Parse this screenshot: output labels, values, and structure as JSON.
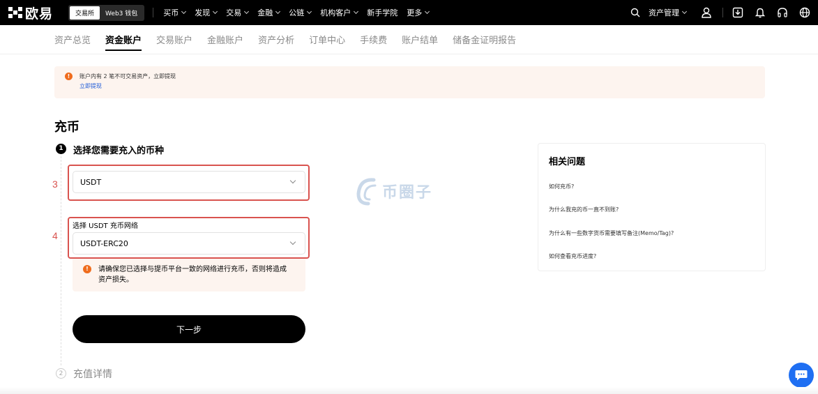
{
  "nav": {
    "logo": "欧易",
    "modes": [
      "交易所",
      "Web3 钱包"
    ],
    "items": [
      "买币",
      "发现",
      "交易",
      "金融",
      "公链",
      "机构客户",
      "新手学院",
      "更多"
    ],
    "has_chevron": [
      true,
      true,
      true,
      true,
      true,
      true,
      false,
      true
    ],
    "asset_mgmt": "资产管理"
  },
  "subtabs": [
    "资产总览",
    "资金账户",
    "交易账户",
    "金融账户",
    "资产分析",
    "订单中心",
    "手续费",
    "账户结单",
    "储备金证明报告"
  ],
  "banner": {
    "text": "账户内有 2 笔不可交易资产，立即提现",
    "link": "立即提现"
  },
  "page": {
    "title": "充币",
    "step1_number": "1",
    "step1_label": "选择您需要充入的币种",
    "step2_number": "2",
    "step2_label": "充值详情"
  },
  "coin_select": {
    "value": "USDT"
  },
  "network": {
    "label": "选择 USDT 充币网络",
    "value": "USDT-ERC20"
  },
  "warning": {
    "text": "请确保您已选择与提币平台一致的网络进行充币，否则将造成资产损失。"
  },
  "next_button": "下一步",
  "annotations": {
    "a3": "3",
    "a4": "4"
  },
  "watermark": "币圈子",
  "faq": {
    "title": "相关问题",
    "items": [
      "如何充币?",
      "为什么我充的币一直不到账?",
      "为什么有一些数字货币需要填写备注(Memo/Tag)?",
      "如何查看充币进度?"
    ]
  },
  "colors": {
    "accent": "#000000",
    "annotation_red": "#d9534f",
    "warning_orange": "#ef6c1d",
    "link_blue": "#1f5bd8",
    "chat_blue": "#1f6ff2"
  }
}
